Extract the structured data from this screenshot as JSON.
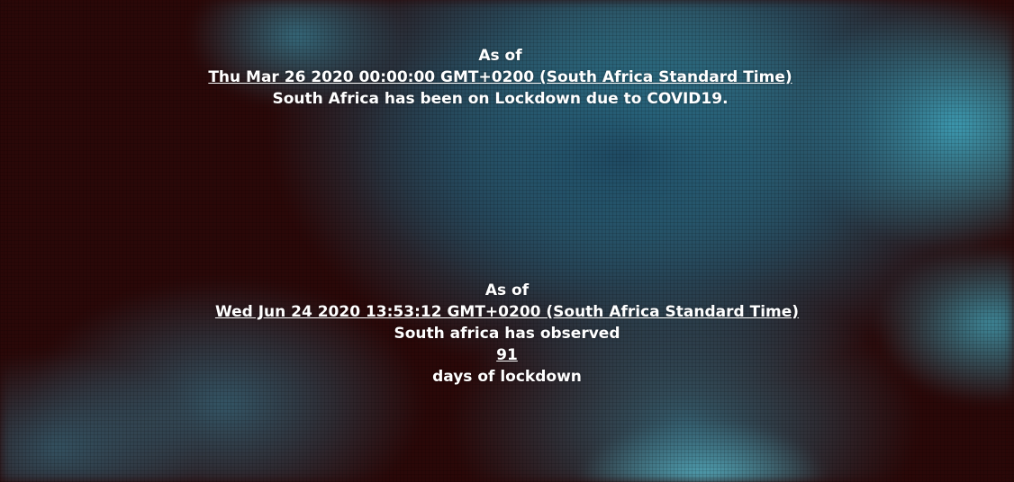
{
  "background": {
    "description_icon": "coronavirus-background-image",
    "colors": {
      "base": "#2a0808",
      "virus": "#3cb4cd"
    }
  },
  "lockdown_start": {
    "as_of_label": "As of",
    "date_text": "Thu Mar 26 2020 00:00:00 GMT+0200 (South Africa Standard Time)",
    "message": "South Africa has been on Lockdown due to COVID19."
  },
  "current_status": {
    "as_of_label": "As of",
    "date_text": "Wed Jun 24 2020 13:53:12 GMT+0200 (South Africa Standard Time)",
    "observed_label": "South africa has observed",
    "days_count": "91",
    "days_label": "days of lockdown"
  }
}
